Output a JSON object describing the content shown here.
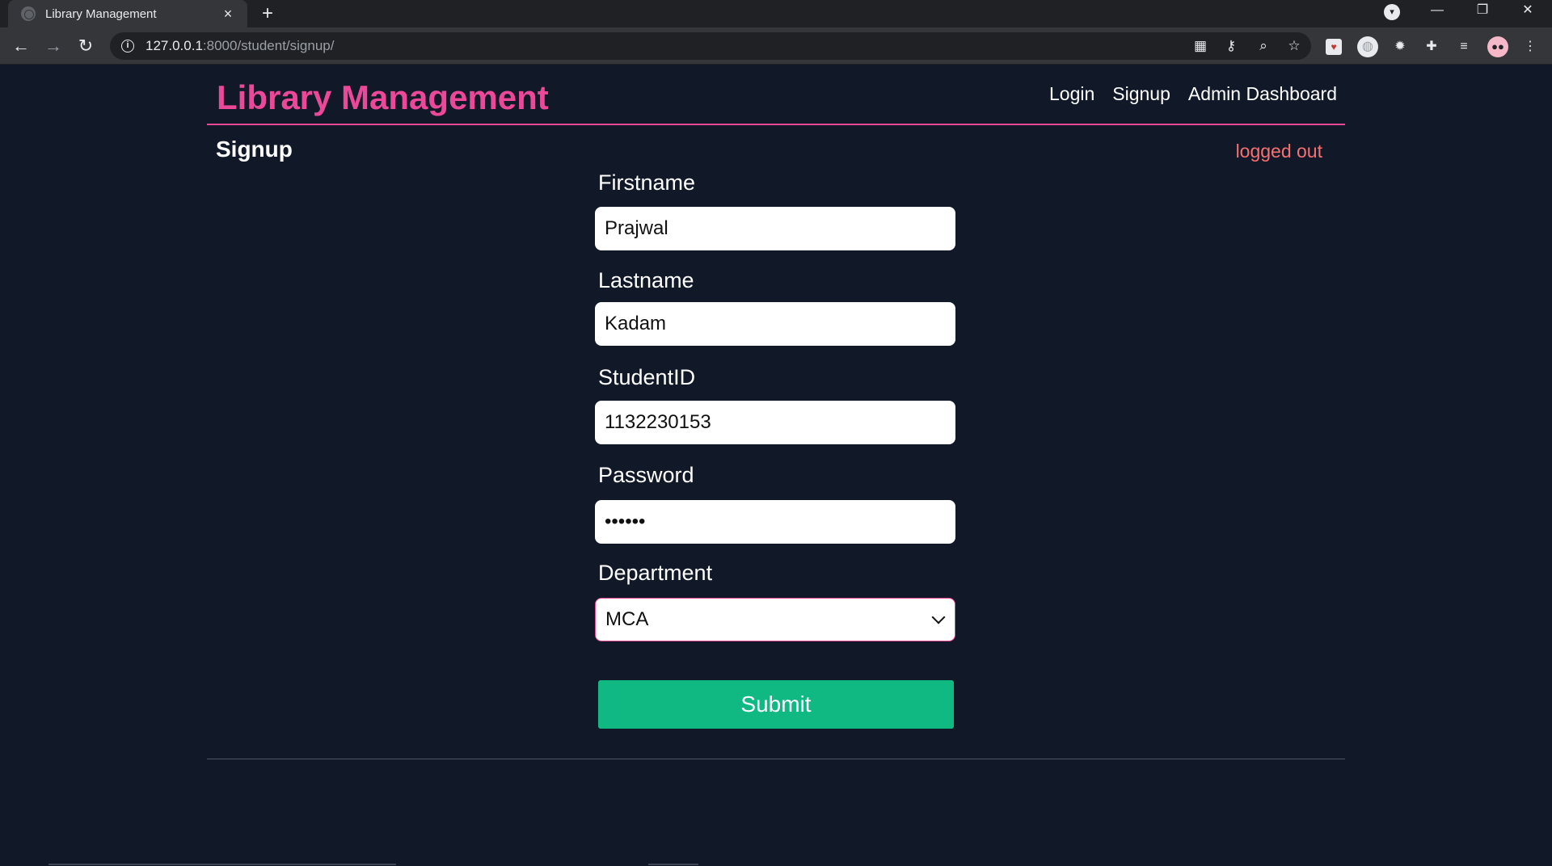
{
  "browser": {
    "tab_title": "Library Management",
    "tab_close": "×",
    "new_tab": "+",
    "url_host": "127.0.0.1",
    "url_path": ":8000/student/signup/",
    "controls": {
      "minimize": "—",
      "restore": "❐",
      "close": "✕"
    }
  },
  "app": {
    "brand": "Library Management",
    "nav": [
      "Login",
      "Signup",
      "Admin Dashboard"
    ],
    "brand_color": "#ec4899",
    "background": "#111827"
  },
  "page": {
    "heading": "Signup",
    "status": "logged out",
    "status_color": "#f87171"
  },
  "form": {
    "firstname": {
      "label": "Firstname",
      "value": "Prajwal"
    },
    "lastname": {
      "label": "Lastname",
      "value": "Kadam"
    },
    "studentid": {
      "label": "StudentID",
      "value": "1132230153"
    },
    "password": {
      "label": "Password",
      "value": "••••••"
    },
    "department": {
      "label": "Department",
      "value": "MCA"
    },
    "submit_label": "Submit",
    "submit_color": "#10b981"
  }
}
